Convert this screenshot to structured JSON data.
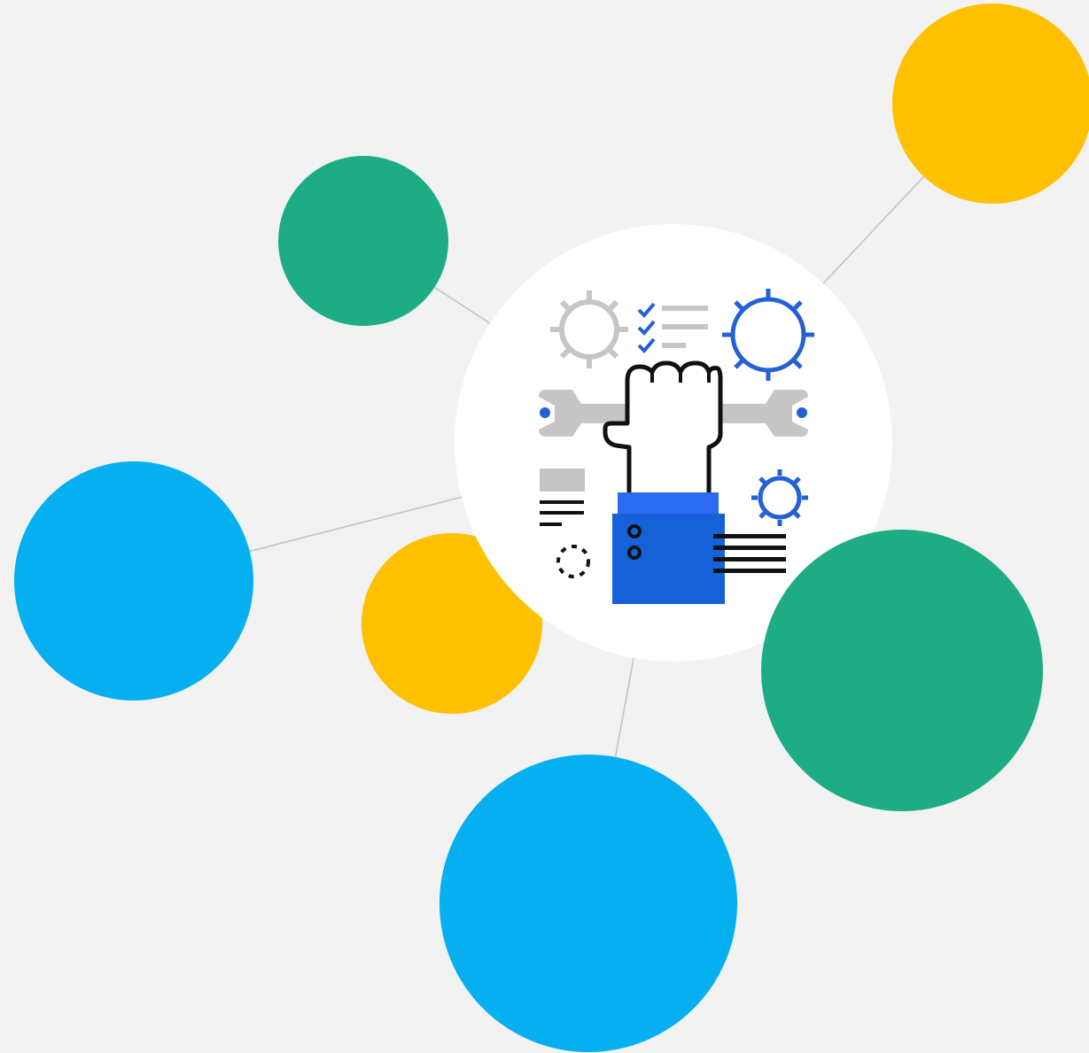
{
  "colors": {
    "background": "#f2f2f2",
    "connector": "#c4c4c4",
    "green": "#1eac84",
    "yellow": "#ffc000",
    "blue": "#05aff0",
    "hub": "#ffffff",
    "icon_gray": "#c6c6c6",
    "icon_blue": "#2461d6",
    "icon_blue_light": "#2b6bf0",
    "icon_black": "#111111"
  },
  "nodes": [
    {
      "name": "node-yellow-top-right",
      "color": "yellow"
    },
    {
      "name": "node-green-top-left",
      "color": "green"
    },
    {
      "name": "node-blue-left",
      "color": "blue"
    },
    {
      "name": "node-yellow-small",
      "color": "yellow"
    },
    {
      "name": "node-blue-bottom",
      "color": "blue"
    },
    {
      "name": "node-green-right",
      "color": "green"
    }
  ],
  "hub_icon": {
    "name": "maintenance-icon",
    "parts": [
      "gear-icon",
      "checklist-icon",
      "wrench-icon",
      "raised-fist-icon",
      "document-icon",
      "shirt-sleeve-icon"
    ]
  }
}
